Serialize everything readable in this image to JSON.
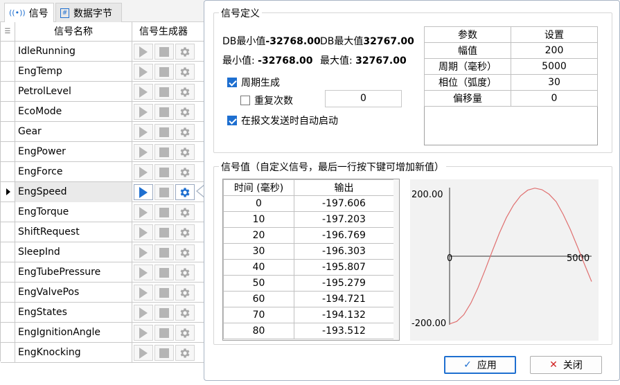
{
  "tabs": [
    {
      "label": "信号",
      "icon": "signal-icon"
    },
    {
      "label": "数据字节",
      "icon": "hash-icon"
    }
  ],
  "grid": {
    "header_name": "信号名称",
    "header_gen": "信号生成器",
    "rows": [
      {
        "name": "IdleRunning"
      },
      {
        "name": "EngTemp"
      },
      {
        "name": "PetrolLevel"
      },
      {
        "name": "EcoMode"
      },
      {
        "name": "Gear"
      },
      {
        "name": "EngPower"
      },
      {
        "name": "EngForce"
      },
      {
        "name": "EngSpeed"
      },
      {
        "name": "EngTorque"
      },
      {
        "name": "ShiftRequest"
      },
      {
        "name": "SleepInd"
      },
      {
        "name": "EngTubePressure"
      },
      {
        "name": "EngValvePos"
      },
      {
        "name": "EngStates"
      },
      {
        "name": "EngIgnitionAngle"
      },
      {
        "name": "EngKnocking"
      }
    ],
    "selected_index": 7
  },
  "definition": {
    "title": "信号定义",
    "db_min_label": "DB最小值",
    "db_min_value": "-32768.00",
    "db_max_label": "DB最大值",
    "db_max_value": "32767.00",
    "min_label": "最小值:",
    "min_value": "-32768.00",
    "max_label": "最大值:",
    "max_value": "32767.00",
    "periodic_label": "周期生成",
    "periodic_checked": true,
    "repeat_label": "重复次数",
    "repeat_checked": false,
    "repeat_value": "0",
    "autostart_label": "在报文发送时自动启动",
    "autostart_checked": true,
    "params": {
      "col_param": "参数",
      "col_setting": "设置",
      "rows": [
        {
          "param": "幅值",
          "value": "200"
        },
        {
          "param": "周期（毫秒）",
          "value": "5000"
        },
        {
          "param": "相位（弧度）",
          "value": "30"
        },
        {
          "param": "偏移量",
          "value": "0"
        }
      ]
    }
  },
  "values": {
    "title": "信号值（自定义信号，最后一行按下键可增加新值）",
    "col_time": "时间 (毫秒)",
    "col_output": "输出",
    "rows": [
      {
        "t": "0",
        "v": "-197.606"
      },
      {
        "t": "10",
        "v": "-197.203"
      },
      {
        "t": "20",
        "v": "-196.769"
      },
      {
        "t": "30",
        "v": "-196.303"
      },
      {
        "t": "40",
        "v": "-195.807"
      },
      {
        "t": "50",
        "v": "-195.279"
      },
      {
        "t": "60",
        "v": "-194.721"
      },
      {
        "t": "70",
        "v": "-194.132"
      },
      {
        "t": "80",
        "v": "-193.512"
      }
    ]
  },
  "chart_data": {
    "type": "line",
    "title": "",
    "xlabel": "",
    "ylabel": "",
    "xlim": [
      0,
      5000
    ],
    "ylim": [
      -200,
      200
    ],
    "x_ticks": [
      "0",
      "5000"
    ],
    "y_ticks": [
      "200.00",
      "-200.00"
    ],
    "series": [
      {
        "color": "#e07070",
        "x": [
          0,
          250,
          500,
          750,
          1000,
          1250,
          1500,
          1750,
          2000,
          2250,
          2500,
          2750,
          3000,
          3250,
          3500,
          3750,
          4000,
          4250,
          4500,
          4750,
          5000
        ],
        "y": [
          -197.6,
          -190.4,
          -170.8,
          -136.6,
          -92.1,
          -40.0,
          14.2,
          66.8,
          112.7,
          149.2,
          176.1,
          192.7,
          198.6,
          194.2,
          181.0,
          159.2,
          122.0,
          78.0,
          28.0,
          -24.0,
          -74.0
        ]
      }
    ]
  },
  "buttons": {
    "apply": "应用",
    "close": "关闭"
  }
}
